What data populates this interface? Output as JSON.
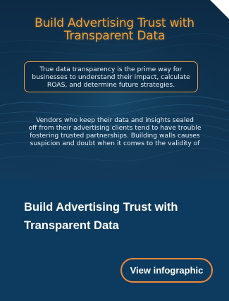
{
  "card": {
    "thumbnail": {
      "title_line1": "Build Advertising Trust with",
      "title_line2": "Transparent Data",
      "callout_line1": "True data transparency is the prime way for",
      "callout_line2": "businesses to understand their impact, calculate",
      "callout_line3": "ROAS, and determine future strategies.",
      "body_line1": "Vendors who keep their data and insights sealed",
      "body_line2": "off from their advertising clients tend to have trouble",
      "body_line3": "fostering trusted partnerships. Building walls causes",
      "body_line4": "suspicion and doubt when it comes to the validity of"
    },
    "title_line1": "Build Advertising Trust with",
    "title_line2": "Transparent Data",
    "cta_label": "View infographic"
  },
  "colors": {
    "card_background": "#0d3b5f",
    "accent": "#f08a3a",
    "thumbnail_title": "#f3a23a"
  }
}
